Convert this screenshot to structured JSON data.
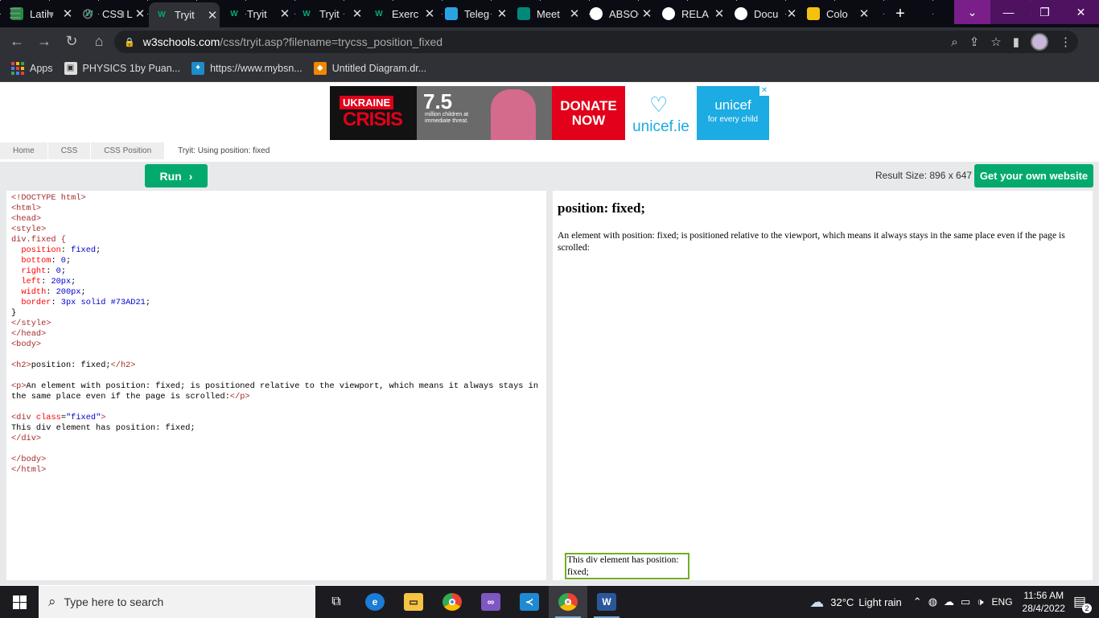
{
  "browser": {
    "tabs": [
      {
        "title": "Latih",
        "favicon": "google-classroom-icon",
        "color": "#1e8e3e"
      },
      {
        "title": "CSS L",
        "favicon": "w3schools-icon",
        "color": "#04aa6d"
      },
      {
        "title": "Tryit",
        "favicon": "w3schools-icon",
        "color": "#04aa6d",
        "active": true
      },
      {
        "title": "Tryit",
        "favicon": "w3schools-icon",
        "color": "#04aa6d"
      },
      {
        "title": "Tryit",
        "favicon": "w3schools-icon",
        "color": "#04aa6d"
      },
      {
        "title": "Exerc",
        "favicon": "w3schools-icon",
        "color": "#04aa6d"
      },
      {
        "title": "Teleg",
        "favicon": "telegram-icon",
        "color": "#2aa3e0"
      },
      {
        "title": "Meet",
        "favicon": "meet-icon",
        "color": "#00897b"
      },
      {
        "title": "ABSO",
        "favicon": "globe-icon",
        "color": "#ffffff"
      },
      {
        "title": "RELA",
        "favicon": "globe-icon",
        "color": "#ffffff"
      },
      {
        "title": "Docu",
        "favicon": "globe-icon",
        "color": "#ffffff"
      },
      {
        "title": "Colo",
        "favicon": "colorzilla-icon",
        "color": "#f4c20d"
      }
    ],
    "url": {
      "host": "w3schools.com",
      "path": "/css/tryit.asp?filename=trycss_position_fixed"
    },
    "bookmarks": [
      {
        "label": "Apps",
        "icon": "apps-grid-icon"
      },
      {
        "label": "PHYSICS 1by Puan...",
        "icon": "classroom-bookmark-icon"
      },
      {
        "label": "https://www.mybsn...",
        "icon": "bsn-bookmark-icon"
      },
      {
        "label": "Untitled Diagram.dr...",
        "icon": "drawio-bookmark-icon"
      }
    ]
  },
  "ad": {
    "title1": "UKRAINE",
    "title2": "CRISIS",
    "stat": "7.5",
    "stat_text": "million children at immediate threat.",
    "donate1": "DONATE",
    "donate2": "NOW",
    "site": "unicef.ie",
    "brand": "unicef",
    "tagline": "for every child",
    "close": "✕"
  },
  "breadcrumbs": [
    "Home",
    "CSS",
    "CSS Position",
    "Tryit: Using position: fixed"
  ],
  "tryit": {
    "run_label": "Run",
    "result_size": "Result Size: 896 x 647",
    "get_website": "Get your own website"
  },
  "code_lines": [
    [
      {
        "c": "tg",
        "t": "<!DOCTYPE html>"
      }
    ],
    [
      {
        "c": "tg",
        "t": "<html>"
      }
    ],
    [
      {
        "c": "tg",
        "t": "<head>"
      }
    ],
    [
      {
        "c": "tg",
        "t": "<style>"
      }
    ],
    [
      {
        "c": "tg",
        "t": "div.fixed {"
      }
    ],
    [
      {
        "c": "",
        "t": "  "
      },
      {
        "c": "pr",
        "t": "position"
      },
      {
        "c": "",
        "t": ": "
      },
      {
        "c": "vl",
        "t": "fixed"
      },
      {
        "c": "",
        "t": ";"
      }
    ],
    [
      {
        "c": "",
        "t": "  "
      },
      {
        "c": "pr",
        "t": "bottom"
      },
      {
        "c": "",
        "t": ": "
      },
      {
        "c": "vl",
        "t": "0"
      },
      {
        "c": "",
        "t": ";"
      }
    ],
    [
      {
        "c": "",
        "t": "  "
      },
      {
        "c": "pr",
        "t": "right"
      },
      {
        "c": "",
        "t": ": "
      },
      {
        "c": "vl",
        "t": "0"
      },
      {
        "c": "",
        "t": ";"
      }
    ],
    [
      {
        "c": "",
        "t": "  "
      },
      {
        "c": "pr",
        "t": "left"
      },
      {
        "c": "",
        "t": ": "
      },
      {
        "c": "vl",
        "t": "20px"
      },
      {
        "c": "",
        "t": ";"
      }
    ],
    [
      {
        "c": "",
        "t": "  "
      },
      {
        "c": "pr",
        "t": "width"
      },
      {
        "c": "",
        "t": ": "
      },
      {
        "c": "vl",
        "t": "200px"
      },
      {
        "c": "",
        "t": ";"
      }
    ],
    [
      {
        "c": "",
        "t": "  "
      },
      {
        "c": "pr",
        "t": "border"
      },
      {
        "c": "",
        "t": ": "
      },
      {
        "c": "vl",
        "t": "3px solid #73AD21"
      },
      {
        "c": "",
        "t": ";"
      }
    ],
    [
      {
        "c": "",
        "t": "}"
      }
    ],
    [
      {
        "c": "tg",
        "t": "</style>"
      }
    ],
    [
      {
        "c": "tg",
        "t": "</head>"
      }
    ],
    [
      {
        "c": "tg",
        "t": "<body>"
      }
    ],
    [
      {
        "c": "",
        "t": ""
      }
    ],
    [
      {
        "c": "tg",
        "t": "<h2>"
      },
      {
        "c": "",
        "t": "position: fixed;"
      },
      {
        "c": "tg",
        "t": "</h2>"
      }
    ],
    [
      {
        "c": "",
        "t": ""
      }
    ],
    [
      {
        "c": "tg",
        "t": "<p>"
      },
      {
        "c": "",
        "t": "An element with position: fixed; is positioned relative to the viewport, which means it always stays in"
      }
    ],
    [
      {
        "c": "",
        "t": "the same place even if the page is scrolled:"
      },
      {
        "c": "tg",
        "t": "</p>"
      }
    ],
    [
      {
        "c": "",
        "t": ""
      }
    ],
    [
      {
        "c": "tg",
        "t": "<div "
      },
      {
        "c": "pr",
        "t": "class"
      },
      {
        "c": "",
        "t": "="
      },
      {
        "c": "vl",
        "t": "\"fixed\""
      },
      {
        "c": "tg",
        "t": ">"
      }
    ],
    [
      {
        "c": "",
        "t": "This div element has position: fixed;"
      }
    ],
    [
      {
        "c": "tg",
        "t": "</div>"
      }
    ],
    [
      {
        "c": "",
        "t": ""
      }
    ],
    [
      {
        "c": "tg",
        "t": "</body>"
      }
    ],
    [
      {
        "c": "tg",
        "t": "</html>"
      }
    ]
  ],
  "result": {
    "heading": "position: fixed;",
    "paragraph": "An element with position: fixed; is positioned relative to the viewport, which means it always stays in the same place even if the page is scrolled:",
    "fixed_div": "This div element has position: fixed;"
  },
  "taskbar": {
    "search_placeholder": "Type here to search",
    "weather_temp": "32°C",
    "weather_text": "Light rain",
    "lang": "ENG",
    "time": "11:56 AM",
    "date": "28/4/2022",
    "notifications": "2"
  },
  "colors": {
    "accent": "#04aa6d",
    "border_green": "#73AD21",
    "chrome_dark": "#2f3136"
  }
}
